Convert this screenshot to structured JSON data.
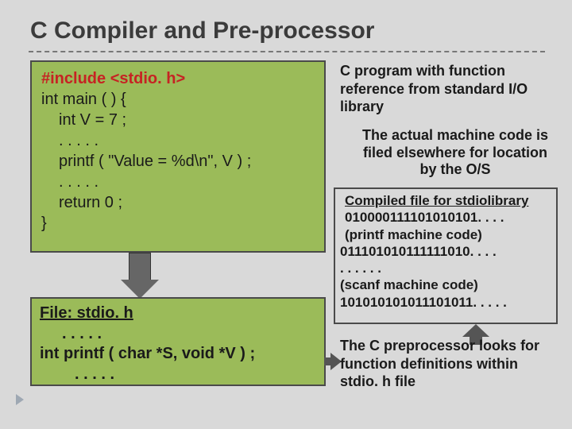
{
  "title": "C Compiler and Pre-processor",
  "code1": {
    "l1": "#include <stdio. h>",
    "l2": "int main ( ) {",
    "l3": "int V = 7 ;",
    "l4": ". . . . .",
    "l5": "printf ( \"Value = %d\\n\", V ) ;",
    "l6": ". . . . .",
    "l7": "return 0 ;",
    "l8": "}"
  },
  "code2": {
    "l1": "File: stdio. h",
    "l2": ". . . . .",
    "l3": "int printf ( char *S, void *V ) ;",
    "l4": ". . . . ."
  },
  "desc1": "C program with function reference from standard I/O library",
  "desc2": "The actual machine code is filed elsewhere for location by the O/S",
  "compiled": {
    "hdr": "Compiled file for stdiolibrary",
    "l1": "010000111101010101. . . .",
    "l2": "(printf machine code)",
    "l3": "011101010111111010. . . .",
    "l4": ". . . . . .",
    "l5": "(scanf machine code)",
    "l6": "101010101011101011. . . . ."
  },
  "desc3": "The C preprocessor looks for function definitions within stdio. h file"
}
